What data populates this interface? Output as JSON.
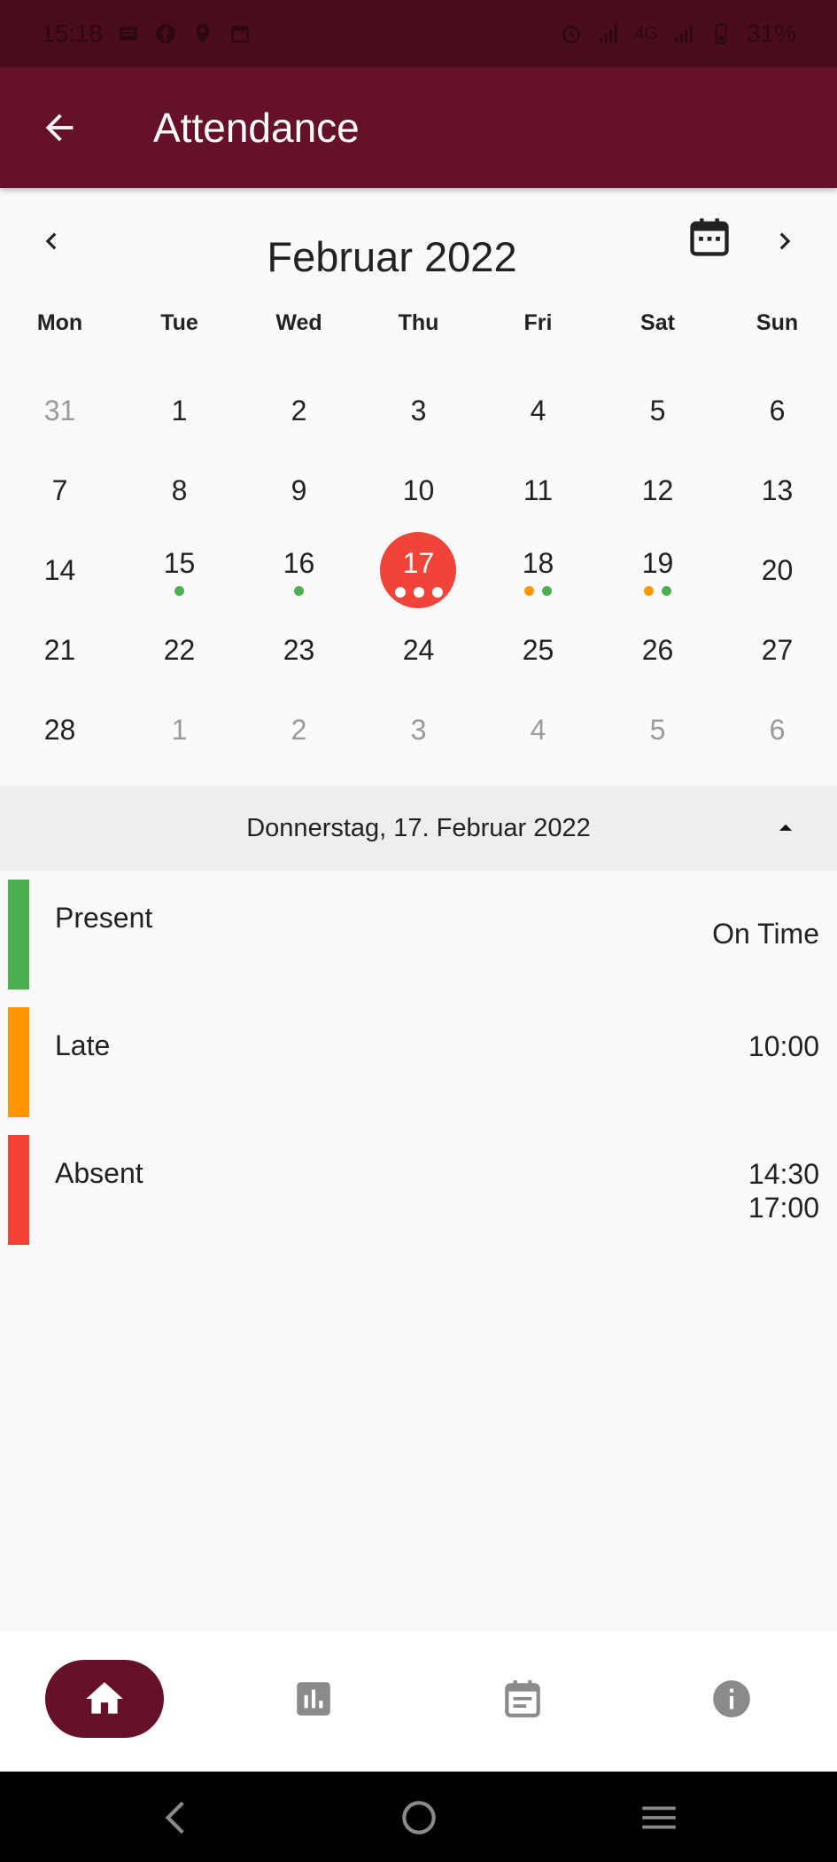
{
  "status_bar": {
    "time": "15:18",
    "network": "4G",
    "battery": "31%"
  },
  "app_bar": {
    "title": "Attendance"
  },
  "calendar": {
    "month_title": "Februar 2022",
    "weekdays": [
      "Mon",
      "Tue",
      "Wed",
      "Thu",
      "Fri",
      "Sat",
      "Sun"
    ],
    "days": [
      {
        "label": "31",
        "other": true,
        "dots": []
      },
      {
        "label": "1",
        "other": false,
        "dots": []
      },
      {
        "label": "2",
        "other": false,
        "dots": []
      },
      {
        "label": "3",
        "other": false,
        "dots": []
      },
      {
        "label": "4",
        "other": false,
        "dots": []
      },
      {
        "label": "5",
        "other": false,
        "dots": []
      },
      {
        "label": "6",
        "other": false,
        "dots": []
      },
      {
        "label": "7",
        "other": false,
        "dots": []
      },
      {
        "label": "8",
        "other": false,
        "dots": []
      },
      {
        "label": "9",
        "other": false,
        "dots": []
      },
      {
        "label": "10",
        "other": false,
        "dots": []
      },
      {
        "label": "11",
        "other": false,
        "dots": []
      },
      {
        "label": "12",
        "other": false,
        "dots": []
      },
      {
        "label": "13",
        "other": false,
        "dots": []
      },
      {
        "label": "14",
        "other": false,
        "dots": []
      },
      {
        "label": "15",
        "other": false,
        "dots": [
          "#4caf50"
        ]
      },
      {
        "label": "16",
        "other": false,
        "dots": [
          "#4caf50"
        ]
      },
      {
        "label": "17",
        "other": false,
        "selected": true,
        "dots": [
          "#ffffff",
          "#ffffff",
          "#ffffff"
        ]
      },
      {
        "label": "18",
        "other": false,
        "dots": [
          "#ff9800",
          "#4caf50"
        ]
      },
      {
        "label": "19",
        "other": false,
        "dots": [
          "#ff9800",
          "#4caf50"
        ]
      },
      {
        "label": "20",
        "other": false,
        "dots": []
      },
      {
        "label": "21",
        "other": false,
        "dots": []
      },
      {
        "label": "22",
        "other": false,
        "dots": []
      },
      {
        "label": "23",
        "other": false,
        "dots": []
      },
      {
        "label": "24",
        "other": false,
        "dots": []
      },
      {
        "label": "25",
        "other": false,
        "dots": []
      },
      {
        "label": "26",
        "other": false,
        "dots": []
      },
      {
        "label": "27",
        "other": false,
        "dots": []
      },
      {
        "label": "28",
        "other": false,
        "dots": []
      },
      {
        "label": "1",
        "other": true,
        "dots": []
      },
      {
        "label": "2",
        "other": true,
        "dots": []
      },
      {
        "label": "3",
        "other": true,
        "dots": []
      },
      {
        "label": "4",
        "other": true,
        "dots": []
      },
      {
        "label": "5",
        "other": true,
        "dots": []
      },
      {
        "label": "6",
        "other": true,
        "dots": []
      }
    ]
  },
  "selected_date": {
    "text": "Donnerstag, 17. Februar 2022"
  },
  "attendance": [
    {
      "label": "Present",
      "values": [
        "On Time"
      ],
      "color": "#4caf50"
    },
    {
      "label": "Late",
      "values": [
        "10:00"
      ],
      "color": "#ff9800"
    },
    {
      "label": "Absent",
      "values": [
        "14:30",
        "17:00"
      ],
      "color": "#f44336"
    }
  ],
  "colors": {
    "primary": "#65112a",
    "status_bar": "#4a0d1c",
    "selected_day": "#f0443a",
    "present": "#4caf50",
    "late": "#ff9800",
    "absent": "#f44336"
  },
  "bottom_nav": [
    {
      "icon": "home-icon",
      "active": true
    },
    {
      "icon": "bar-chart-icon",
      "active": false
    },
    {
      "icon": "event-note-icon",
      "active": false
    },
    {
      "icon": "info-icon",
      "active": false
    }
  ]
}
